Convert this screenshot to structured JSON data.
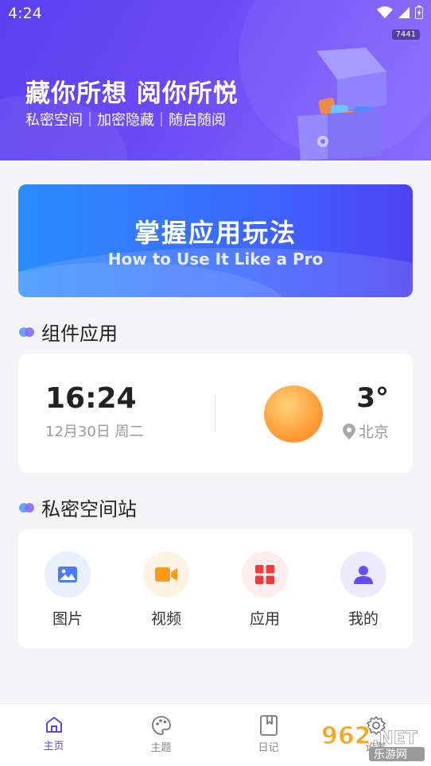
{
  "status": {
    "time": "4:24",
    "build": "7441"
  },
  "hero": {
    "title": "藏你所想 阅你所悦",
    "subtitle": "私密空间｜加密隐藏｜随启随阅"
  },
  "banner": {
    "title_cn": "掌握应用玩法",
    "title_en": "How to Use It Like a Pro"
  },
  "widgets": {
    "section_title": "组件应用",
    "clock": "16:24",
    "date": "12月30日 周二",
    "temperature": "3°",
    "city": "北京"
  },
  "private_station": {
    "section_title": "私密空间站",
    "apps": [
      {
        "label": "图片",
        "icon": "image-icon",
        "bg": "#e8efff",
        "color": "#4a7cf6"
      },
      {
        "label": "视频",
        "icon": "video-icon",
        "bg": "#fff3e3",
        "color": "#ff9b1a"
      },
      {
        "label": "应用",
        "icon": "apps-grid-icon",
        "bg": "#ffecec",
        "color": "#f23c3c"
      },
      {
        "label": "我的",
        "icon": "user-icon",
        "bg": "#eeeaff",
        "color": "#6a4cf6"
      }
    ]
  },
  "tabbar": {
    "tabs": [
      {
        "label": "主页",
        "icon": "home-icon",
        "active": true
      },
      {
        "label": "主题",
        "icon": "palette-icon",
        "active": false
      },
      {
        "label": "日记",
        "icon": "diary-icon",
        "active": false
      },
      {
        "label": "设置",
        "icon": "settings-icon",
        "active": false
      }
    ]
  },
  "watermark": {
    "text": "962.NET",
    "sub": "乐游网"
  },
  "colors": {
    "accent": "#5b44f0",
    "hero_start": "#5b3ff0",
    "banner_start": "#2b8cff"
  }
}
